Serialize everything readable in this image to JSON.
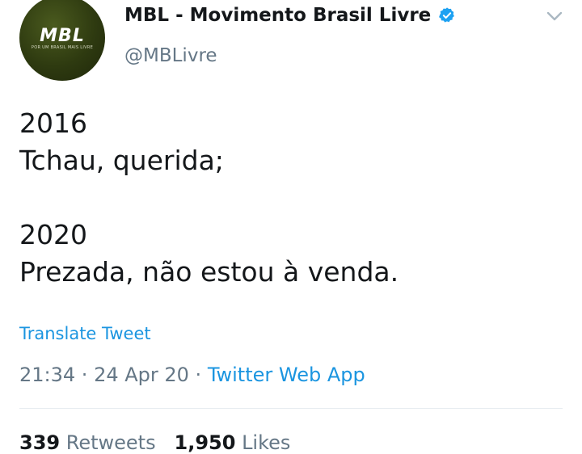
{
  "account": {
    "name": "MBL - Movimento Brasil Livre",
    "handle": "@MBLivre",
    "avatar_logo": "MBL",
    "avatar_tagline": "POR UM BRASIL MAIS LIVRE",
    "verified": true
  },
  "icons": {
    "verified": "verified-badge-icon",
    "more": "chevron-down-icon"
  },
  "tweet": {
    "text": "2016\nTchau, querida;\n\n2020\nPrezada, não estou à venda."
  },
  "translate_label": "Translate Tweet",
  "meta": {
    "time": "21:34",
    "separator1": " · ",
    "date": "24 Apr 20",
    "separator2": " · ",
    "source": "Twitter Web App"
  },
  "stats": {
    "retweets_count": "339",
    "retweets_label": "Retweets",
    "likes_count": "1,950",
    "likes_label": "Likes"
  },
  "colors": {
    "link": "#1b95e0",
    "secondary_text": "#657786",
    "primary_text": "#14171a",
    "divider": "#e6ecf0"
  }
}
